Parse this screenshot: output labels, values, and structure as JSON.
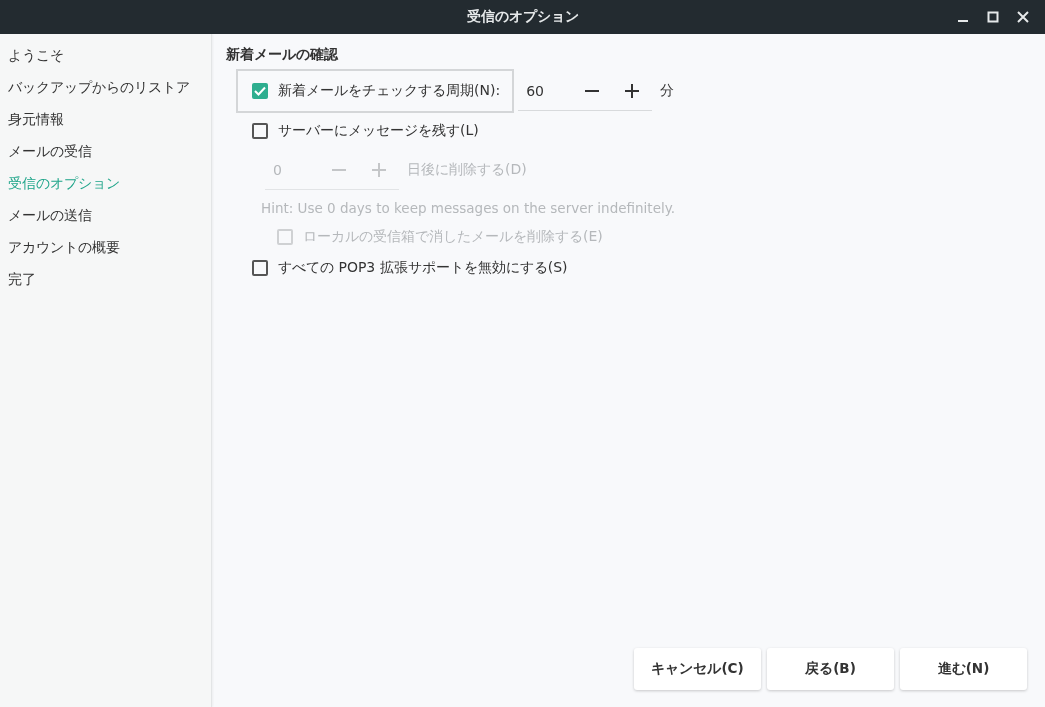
{
  "window": {
    "title": "受信のオプション"
  },
  "sidebar": {
    "items": [
      {
        "label": "ようこそ",
        "selected": false
      },
      {
        "label": "バックアップからのリストア",
        "selected": false
      },
      {
        "label": "身元情報",
        "selected": false
      },
      {
        "label": "メールの受信",
        "selected": false
      },
      {
        "label": "受信のオプション",
        "selected": true
      },
      {
        "label": "メールの送信",
        "selected": false
      },
      {
        "label": "アカウントの概要",
        "selected": false
      },
      {
        "label": "完了",
        "selected": false
      }
    ]
  },
  "section_title": "新着メールの確認",
  "options": [
    {
      "kind": "check_spin",
      "label": "新着メールをチェックする周期(N):",
      "checked": true,
      "focused": true,
      "value": "60",
      "unit": "分",
      "disabled": false
    },
    {
      "kind": "check",
      "label": "サーバーにメッセージを残す(L)",
      "checked": false,
      "disabled": false
    },
    {
      "kind": "spin",
      "value": "0",
      "suffix": "日後に削除する(D)",
      "disabled": true
    },
    {
      "kind": "hint",
      "text": "Hint: Use 0 days to keep messages on the server indefinitely.",
      "disabled": true
    },
    {
      "kind": "subcheck",
      "label": "ローカルの受信箱で消したメールを削除する(E)",
      "checked": false,
      "disabled": true
    },
    {
      "kind": "check",
      "label": "すべての POP3 拡張サポートを無効にする(S)",
      "checked": false,
      "disabled": false
    }
  ],
  "buttons": [
    "キャンセル(C)",
    "戻る(B)",
    "進む(N)"
  ]
}
